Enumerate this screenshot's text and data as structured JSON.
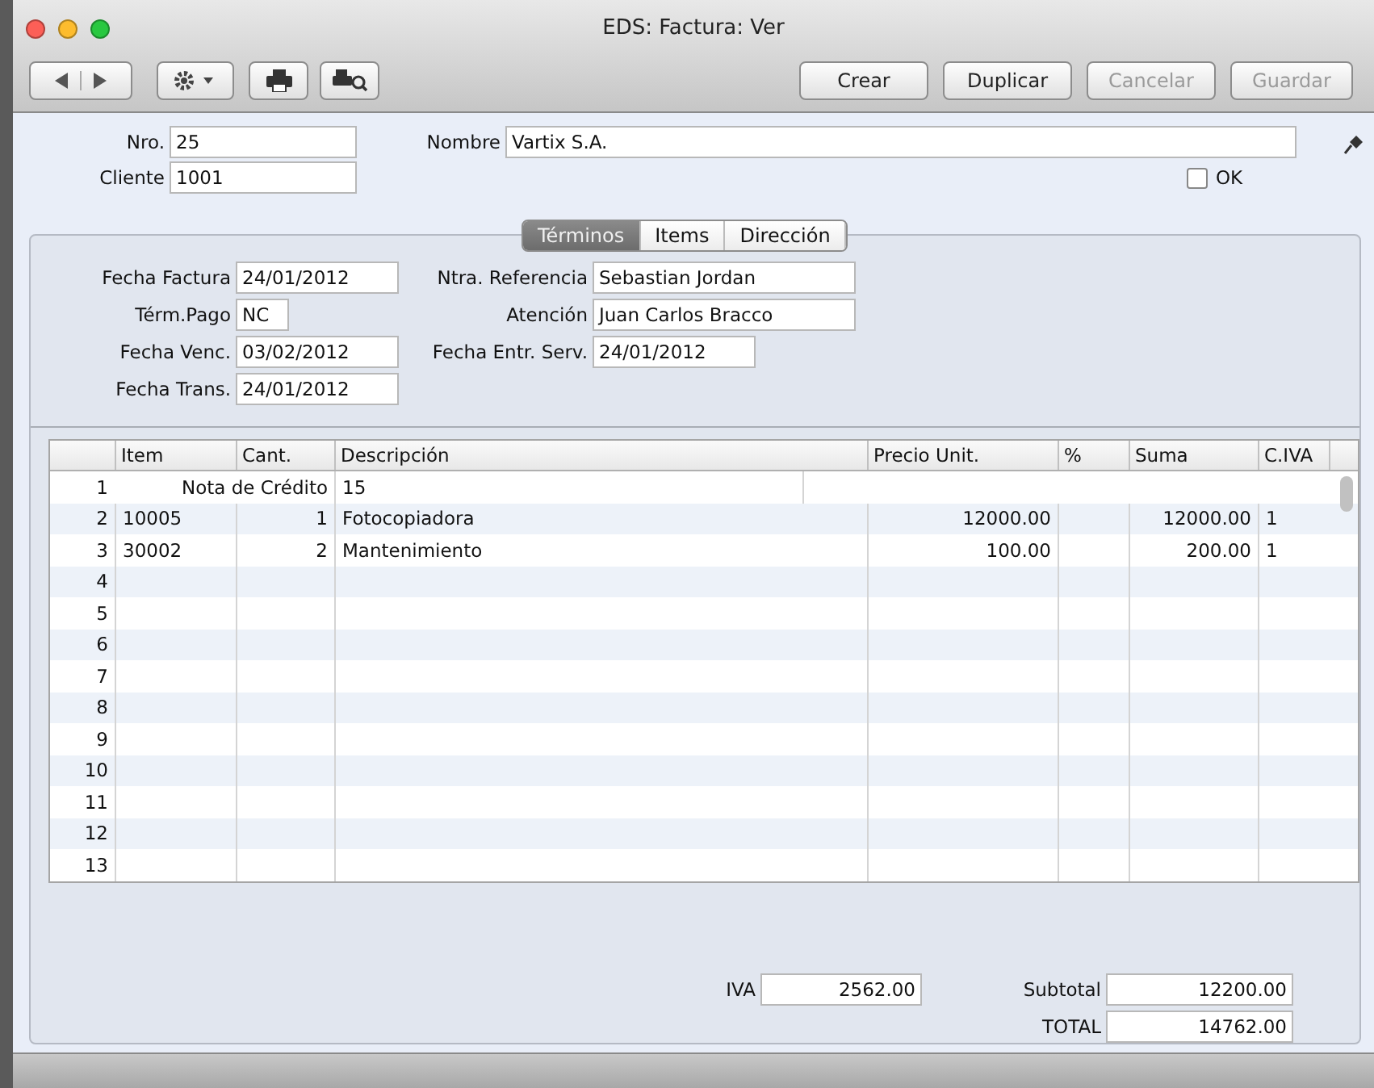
{
  "window": {
    "title": "EDS: Factura: Ver"
  },
  "toolbar": {
    "actions": [
      {
        "label": "Crear",
        "disabled": false
      },
      {
        "label": "Duplicar",
        "disabled": false
      },
      {
        "label": "Cancelar",
        "disabled": true
      },
      {
        "label": "Guardar",
        "disabled": true
      }
    ]
  },
  "header": {
    "nro": {
      "label": "Nro.",
      "value": "25"
    },
    "cliente": {
      "label": "Cliente",
      "value": "1001"
    },
    "nombre": {
      "label": "Nombre",
      "value": "Vartix S.A."
    },
    "ok": {
      "label": "OK",
      "checked": false
    }
  },
  "tabs": [
    {
      "label": "Términos",
      "selected": true
    },
    {
      "label": "Items",
      "selected": false
    },
    {
      "label": "Dirección",
      "selected": false
    }
  ],
  "terms_left": [
    {
      "label": "Fecha Factura",
      "value": "24/01/2012"
    },
    {
      "label": "Térm.Pago",
      "value": "NC"
    },
    {
      "label": "Fecha Venc.",
      "value": "03/02/2012"
    },
    {
      "label": "Fecha Trans.",
      "value": "24/01/2012"
    }
  ],
  "terms_right": [
    {
      "label": "Ntra. Referencia",
      "value": "Sebastian Jordan"
    },
    {
      "label": "Atención",
      "value": "Juan Carlos Bracco"
    },
    {
      "label": "Fecha Entr. Serv.",
      "value": "24/01/2012"
    }
  ],
  "table": {
    "columns": [
      "Item",
      "Cant.",
      "Descripción",
      "Precio Unit.",
      "%",
      "Suma",
      "C.IVA"
    ],
    "rows": [
      {
        "number": "1",
        "kind": "note",
        "label": "Nota de Crédito",
        "value": "15"
      },
      {
        "number": "2",
        "kind": "item",
        "item": "10005",
        "qty": "1",
        "description": "Fotocopiadora",
        "price": "12000.00",
        "sum": "12000.00",
        "vat": "1"
      },
      {
        "number": "3",
        "kind": "item",
        "item": "30002",
        "qty": "2",
        "description": "Mantenimiento",
        "price": "100.00",
        "sum": "200.00",
        "vat": "1"
      },
      {
        "number": "4",
        "kind": "empty"
      },
      {
        "number": "5",
        "kind": "empty"
      },
      {
        "number": "6",
        "kind": "empty"
      },
      {
        "number": "7",
        "kind": "empty"
      },
      {
        "number": "8",
        "kind": "empty"
      },
      {
        "number": "9",
        "kind": "empty"
      },
      {
        "number": "10",
        "kind": "empty"
      },
      {
        "number": "11",
        "kind": "empty"
      },
      {
        "number": "12",
        "kind": "empty"
      },
      {
        "number": "13",
        "kind": "empty"
      }
    ]
  },
  "totals": {
    "iva": {
      "label": "IVA",
      "value": "2562.00"
    },
    "subtotal": {
      "label": "Subtotal",
      "value": "12200.00"
    },
    "total": {
      "label": "TOTAL",
      "value": "14762.00"
    }
  }
}
